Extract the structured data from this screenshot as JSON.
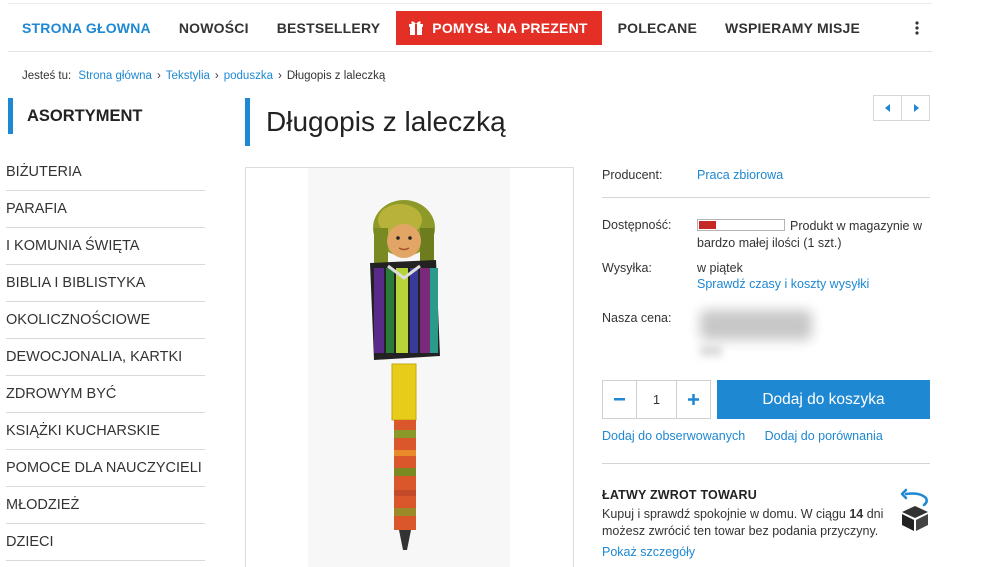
{
  "nav": {
    "items": [
      "STRONA GŁOWNA",
      "NOWOŚCI",
      "BESTSELLERY",
      "POMYSŁ NA PREZENT",
      "POLECANE",
      "WSPIERAMY MISJE"
    ],
    "active_index": 0,
    "highlight_index": 3,
    "more_icon": "vertical-dots-icon"
  },
  "breadcrumb": {
    "prefix": "Jesteś tu:",
    "items": [
      "Strona główna",
      "Tekstylia",
      "poduszka",
      "Długopis z laleczką"
    ]
  },
  "sidebar": {
    "title": "ASORTYMENT",
    "items": [
      "BIŻUTERIA",
      "PARAFIA",
      "I KOMUNIA ŚWIĘTA",
      "BIBLIA I BIBLISTYKA",
      "OKOLICZNOŚCIOWE",
      "DEWOCJONALIA, KARTKI",
      "ZDROWYM BYĆ",
      "KSIĄŻKI KUCHARSKIE",
      "POMOCE DLA NAUCZYCIELI",
      "MŁODZIEŻ",
      "DZIECI"
    ]
  },
  "product": {
    "title": "Długopis z laleczką",
    "producer_label": "Producent:",
    "producer_value": "Praca zbiorowa",
    "availability_label": "Dostępność:",
    "availability_text": "Produkt w magazynie w bardzo małej ilości (1 szt.)",
    "stock_level_fraction": 0.2,
    "shipping_label": "Wysyłka:",
    "shipping_value": "w piątek",
    "shipping_link": "Sprawdź czasy i koszty wysyłki",
    "price_label": "Nasza cena:",
    "quantity": "1",
    "add_to_cart": "Dodaj do koszyka",
    "watch_link": "Dodaj do obserwowanych",
    "compare_link": "Dodaj do porównania"
  },
  "returns": {
    "title": "ŁATWY ZWROT TOWARU",
    "text_before": "Kupuj i sprawdź spokojnie w domu. W ciągu ",
    "days": "14",
    "text_after": " dni możesz zwrócić ten towar bez podania przyczyny.",
    "details_link": "Pokaż szczegóły"
  },
  "colors": {
    "accent": "#1e88d2",
    "gift_button": "#e32f26",
    "stock_bar": "#c62828"
  }
}
